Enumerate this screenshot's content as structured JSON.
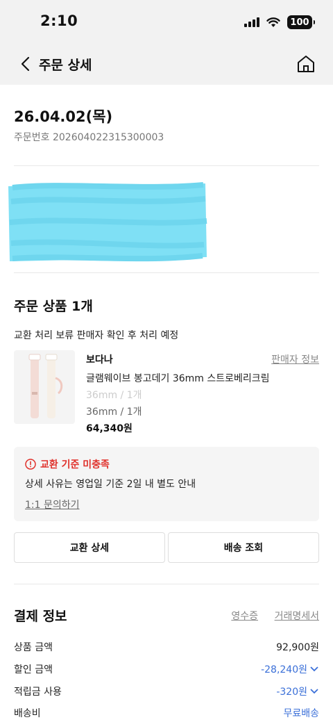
{
  "status_bar": {
    "time": "2:10",
    "battery": "100"
  },
  "nav": {
    "title": "주문 상세"
  },
  "order": {
    "date": "26.04.02(목)",
    "number_label": "주문번호",
    "number": "202604022315300003"
  },
  "items_section": {
    "title": "주문 상품 1개",
    "status": "교환 처리 보류 판매자 확인 후 처리 예정"
  },
  "product": {
    "seller": "보다나",
    "seller_info": "판매자 정보",
    "name": "글램웨이브 봉고데기 36mm 스트로베리크림",
    "option_orig": "36mm / 1개",
    "option": "36mm / 1개",
    "price": "64,340원"
  },
  "notice": {
    "title": "교환 기준 미충족",
    "body": "상세 사유는 영업일 기준 2일 내 별도 안내",
    "link": "1:1 문의하기"
  },
  "buttons": {
    "exchange_detail": "교환 상세",
    "delivery_track": "배송 조회"
  },
  "payment": {
    "title": "결제 정보",
    "receipt": "영수증",
    "statement": "거래명세서",
    "rows": [
      {
        "label": "상품 금액",
        "value": "92,900원"
      },
      {
        "label": "할인 금액",
        "value": "-28,240원"
      },
      {
        "label": "적립금 사용",
        "value": "-320원"
      },
      {
        "label": "배송비",
        "value": "무료배송"
      }
    ]
  },
  "colors": {
    "alert": "#e0312b",
    "link_blue": "#3a6fd8",
    "redaction": "#7fe0f5"
  }
}
